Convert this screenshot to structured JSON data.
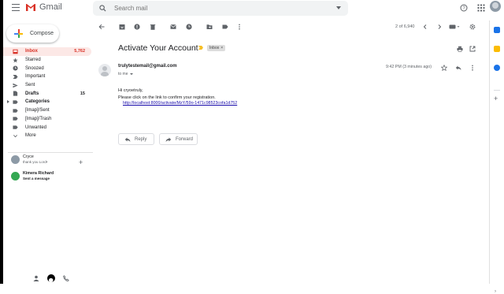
{
  "app": {
    "name": "Gmail"
  },
  "search": {
    "placeholder": "Search mail"
  },
  "compose": {
    "label": "Compose"
  },
  "nav": [
    {
      "label": "Inbox",
      "count": "5,762",
      "icon": "inbox-icon",
      "active": true
    },
    {
      "label": "Starred",
      "count": "",
      "icon": "star-icon"
    },
    {
      "label": "Snoozed",
      "count": "",
      "icon": "clock-icon"
    },
    {
      "label": "Important",
      "count": "",
      "icon": "important-icon"
    },
    {
      "label": "Sent",
      "count": "",
      "icon": "send-icon"
    },
    {
      "label": "Drafts",
      "count": "15",
      "icon": "draft-icon",
      "bold": true
    },
    {
      "label": "Categories",
      "count": "",
      "icon": "label-icon",
      "bold": true,
      "expandable": true
    },
    {
      "label": "[Imap]/Sent",
      "count": "",
      "icon": "label-icon"
    },
    {
      "label": "[Imap]/Trash",
      "count": "",
      "icon": "label-icon"
    },
    {
      "label": "Unwanted",
      "count": "",
      "icon": "label-icon"
    },
    {
      "label": "More",
      "count": "",
      "icon": "chevron-down-icon"
    }
  ],
  "hangouts": [
    {
      "name": "Cryce",
      "status": "thank you Lord•",
      "color": "#8d9aa6"
    },
    {
      "name": "Kimera Richard",
      "status": "Sent a message",
      "color": "#34a853"
    }
  ],
  "toolbar": {
    "counter": "2 of 6,940"
  },
  "email": {
    "subject": "Activate Your Account",
    "label_chip": "Inbox",
    "sender": "trulytestemail@gmail.com",
    "to": "to me",
    "time": "9:42 PM (3 minutes ago)",
    "greeting": "Hi cryoetruly,",
    "instruction": "Please click on the link to confirm your registration.",
    "link": "http://localhost:8000/activate/MzY/59o-1471c98523cofa1d752"
  },
  "actions": {
    "reply": "Reply",
    "forward": "Forward"
  },
  "colors": {
    "accent": "#d93025",
    "active_bg": "#fce8e6",
    "link": "#1a0dab"
  }
}
